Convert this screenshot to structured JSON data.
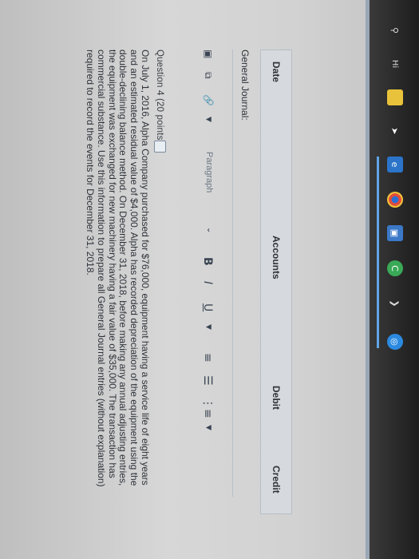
{
  "question": {
    "title": "Question 4",
    "points": "(20 points)",
    "body": "On July 1, 2016, Alpha Company purchased for $76,000, equipment having a service life of eight years and an estimated residual value of $4,000. Alpha has recorded depreciation of the equipment using the double-declining balance method. On December 31, 2018, before making any annual adjusting entries, the equipment was exchanged for new machinery having a fair value of $35,000. The transaction has commercial substance. Use this information to prepare all General Journal entries (without explanation) required to record the events for December 31, 2018."
  },
  "toolbar": {
    "paragraph_label": "Paragraph",
    "bold_label": "B",
    "italic_label": "I",
    "underline_label": "U"
  },
  "journal": {
    "label": "General Journal:",
    "columns": [
      "Date",
      "Accounts",
      "Debit",
      "Credit"
    ]
  },
  "taskbar": {
    "icons": [
      "pin-icon",
      "hi-icon",
      "file-icon",
      "cursor-icon",
      "ie-icon",
      "chrome-icon",
      "store-icon",
      "camera-icon",
      "pointer-icon",
      "safari-icon"
    ]
  }
}
